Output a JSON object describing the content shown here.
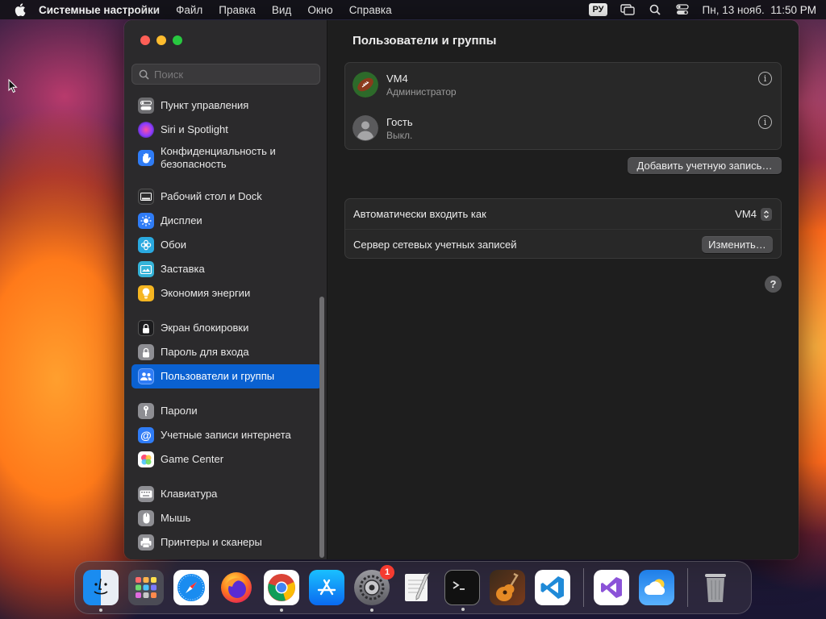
{
  "menubar": {
    "app_name": "Системные настройки",
    "menus": [
      "Файл",
      "Правка",
      "Вид",
      "Окно",
      "Справка"
    ],
    "keyboard_layout": "РУ",
    "clock": "Пн, 13 нояб.  11:50 PM"
  },
  "sidebar": {
    "search_placeholder": "Поиск",
    "items": [
      {
        "label": "Пункт управления",
        "icon": "control-center-icon",
        "color": "#6d6d70"
      },
      {
        "label": "Siri и Spotlight",
        "icon": "siri-icon",
        "color": "#b04cd8"
      },
      {
        "label": "Конфиденциальность и безопасность",
        "icon": "hand-icon",
        "color": "#2f7cf6"
      },
      {
        "label": "Рабочий стол и Dock",
        "icon": "dock-icon",
        "color": "#2c2c2e"
      },
      {
        "label": "Дисплеи",
        "icon": "sun-icon",
        "color": "#2f7cf6"
      },
      {
        "label": "Обои",
        "icon": "flower-icon",
        "color": "#2aa9e0"
      },
      {
        "label": "Заставка",
        "icon": "screensaver-icon",
        "color": "#35b3d8"
      },
      {
        "label": "Экономия энергии",
        "icon": "bulb-icon",
        "color": "#f5b521"
      },
      {
        "label": "Экран блокировки",
        "icon": "lock-screen-icon",
        "color": "#1c1c1e"
      },
      {
        "label": "Пароль для входа",
        "icon": "lock-icon",
        "color": "#8e8e93"
      },
      {
        "label": "Пользователи и группы",
        "icon": "users-icon",
        "color": "#2f7cf6"
      },
      {
        "label": "Пароли",
        "icon": "key-icon",
        "color": "#8e8e93"
      },
      {
        "label": "Учетные записи интернета",
        "icon": "at-icon",
        "color": "#2f7cf6"
      },
      {
        "label": "Game Center",
        "icon": "game-center-icon",
        "color": "#ffffff"
      },
      {
        "label": "Клавиатура",
        "icon": "keyboard-icon",
        "color": "#8e8e93"
      },
      {
        "label": "Мышь",
        "icon": "mouse-icon",
        "color": "#8e8e93"
      },
      {
        "label": "Принтеры и сканеры",
        "icon": "printer-icon",
        "color": "#8e8e93"
      }
    ],
    "selected_index": 10
  },
  "main": {
    "title": "Пользователи и группы",
    "users": [
      {
        "name": "VM4",
        "role": "Администратор",
        "avatar": "football-avatar"
      },
      {
        "name": "Гость",
        "role": "Выкл.",
        "avatar": "guest-avatar"
      }
    ],
    "add_account_label": "Добавить учетную запись…",
    "auto_login_label": "Автоматически входить как",
    "auto_login_value": "VM4",
    "network_server_label": "Сервер сетевых учетных записей",
    "change_label": "Изменить…",
    "help_label": "?"
  },
  "dock": {
    "apps": [
      {
        "name": "Finder",
        "icon": "finder-icon",
        "running": true
      },
      {
        "name": "Launchpad",
        "icon": "launchpad-icon",
        "running": false
      },
      {
        "name": "Safari",
        "icon": "safari-icon",
        "running": false
      },
      {
        "name": "Firefox",
        "icon": "firefox-icon",
        "running": false
      },
      {
        "name": "Chrome",
        "icon": "chrome-icon",
        "running": true
      },
      {
        "name": "App Store",
        "icon": "app-store-icon",
        "running": false
      },
      {
        "name": "System Settings",
        "icon": "system-settings-icon",
        "running": true,
        "badge": "1"
      },
      {
        "name": "TextEdit",
        "icon": "textedit-icon",
        "running": false
      },
      {
        "name": "Terminal",
        "icon": "terminal-icon",
        "running": true
      },
      {
        "name": "GarageBand",
        "icon": "garageband-icon",
        "running": false
      },
      {
        "name": "VS Code",
        "icon": "vscode-icon",
        "running": false
      },
      {
        "name": "Visual Studio",
        "icon": "visual-studio-icon",
        "running": false
      },
      {
        "name": "Weather",
        "icon": "weather-icon",
        "running": false
      },
      {
        "name": "Trash",
        "icon": "trash-icon",
        "running": false
      }
    ]
  },
  "colors": {
    "accent": "#0a61d1",
    "window_bg": "#1e1e1e",
    "sidebar_bg": "#2b2a2c"
  }
}
